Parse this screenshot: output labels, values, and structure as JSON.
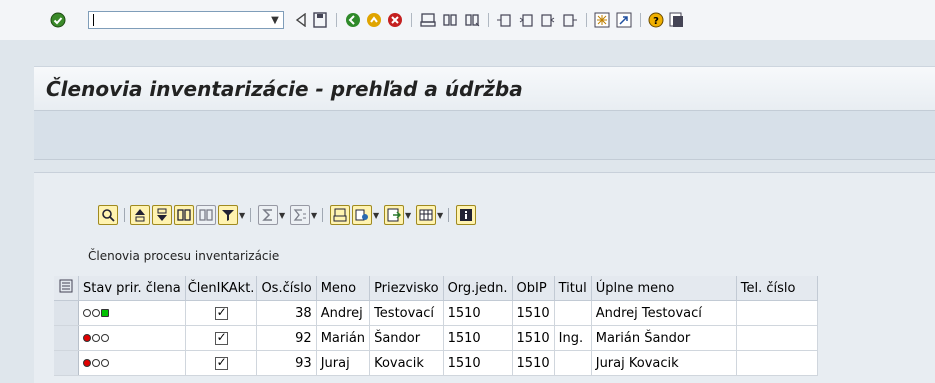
{
  "toolbar": {
    "command_value": "",
    "icons": [
      "enter-icon",
      "back-icon",
      "save-icon",
      "back-green-icon",
      "exit-icon",
      "cancel-icon",
      "print-icon",
      "find-icon",
      "find-next-icon",
      "first-page-icon",
      "previous-page-icon",
      "next-page-icon",
      "last-page-icon",
      "create-session-icon",
      "shortcut-icon",
      "help-icon",
      "layout-icon"
    ]
  },
  "screen": {
    "title": "Členovia inventarizácie - prehľad a údržba"
  },
  "alv": {
    "grid_title": "Členovia procesu inventarizácie",
    "columns": [
      "Stav prir. člena",
      "ČlenIKAkt.",
      "Os.číslo",
      "Meno",
      "Priezvisko",
      "Org.jedn.",
      "ObIP",
      "Titul",
      "Úplne meno",
      "Tel. číslo"
    ],
    "rows": [
      {
        "status": "green",
        "active": true,
        "os_cislo": "38",
        "meno": "Andrej",
        "priezvisko": "Testovací",
        "org": "1510",
        "obip": "1510",
        "titul": "",
        "uplne": "Andrej Testovací",
        "tel": ""
      },
      {
        "status": "red",
        "active": true,
        "os_cislo": "92",
        "meno": "Marián",
        "priezvisko": "Šandor",
        "org": "1510",
        "obip": "1510",
        "titul": "Ing.",
        "uplne": "Marián Šandor",
        "tel": ""
      },
      {
        "status": "red",
        "active": true,
        "os_cislo": "93",
        "meno": "Juraj",
        "priezvisko": "Kovacik",
        "org": "1510",
        "obip": "1510",
        "titul": "",
        "uplne": "Juraj Kovacik",
        "tel": ""
      }
    ]
  }
}
